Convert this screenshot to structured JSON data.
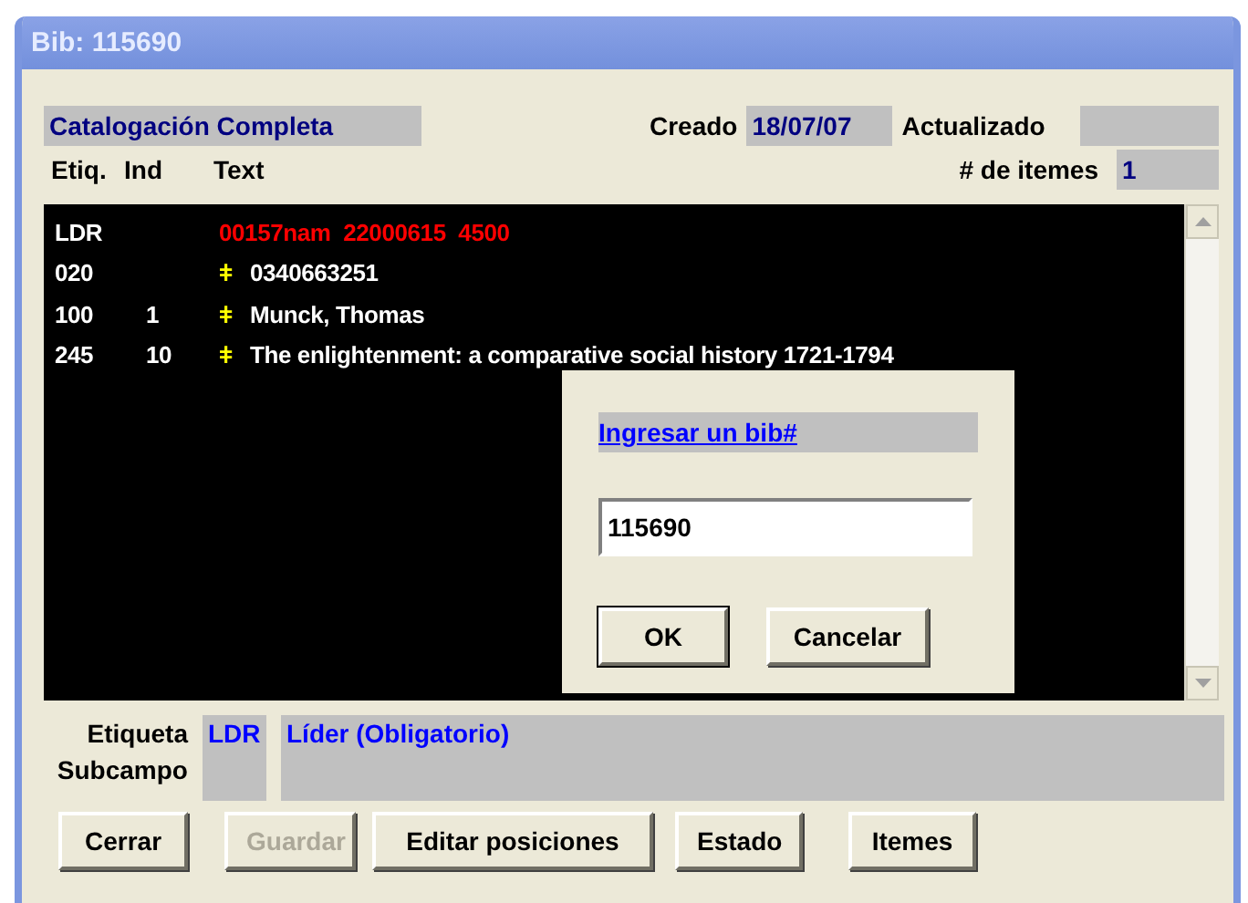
{
  "window": {
    "title": "Bib: 115690"
  },
  "header": {
    "catalog_level": "Catalogación Completa",
    "created_label": "Creado",
    "created_value": "18/07/07",
    "updated_label": "Actualizado",
    "items_label": "# de itemes",
    "items_value": "1"
  },
  "columns": [
    "Etiq.",
    "Ind",
    "Text"
  ],
  "records": [
    {
      "tag": "LDR",
      "text": "00157nam  22000615  4500",
      "kind": "leader"
    },
    {
      "tag": "020",
      "delimiter": "ǂ",
      "text": "0340663251",
      "kind": "field"
    },
    {
      "tag": "100",
      "ind": "1",
      "delimiter": "ǂ",
      "text": "Munck, Thomas",
      "kind": "field"
    },
    {
      "tag": "245",
      "ind": "10",
      "delimiter": "ǂ",
      "text": "The enlightenment: a comparative social history 1721-1794",
      "kind": "field"
    }
  ],
  "dialog": {
    "link": "Ingresar un bib#",
    "value": "115690",
    "buttons": [
      "OK",
      "Cancelar"
    ]
  },
  "footer": {
    "tag_label": "Etiqueta",
    "subfield_label": "Subcampo",
    "tag_value": "LDR",
    "description": "Líder (Obligatorio)"
  },
  "buttons": [
    {
      "label": "Cerrar",
      "disabled": false
    },
    {
      "label": "Guardar",
      "disabled": true
    },
    {
      "label": "Editar posiciones",
      "disabled": false
    },
    {
      "label": "Estado",
      "disabled": false
    },
    {
      "label": "Itemes",
      "disabled": false
    }
  ]
}
